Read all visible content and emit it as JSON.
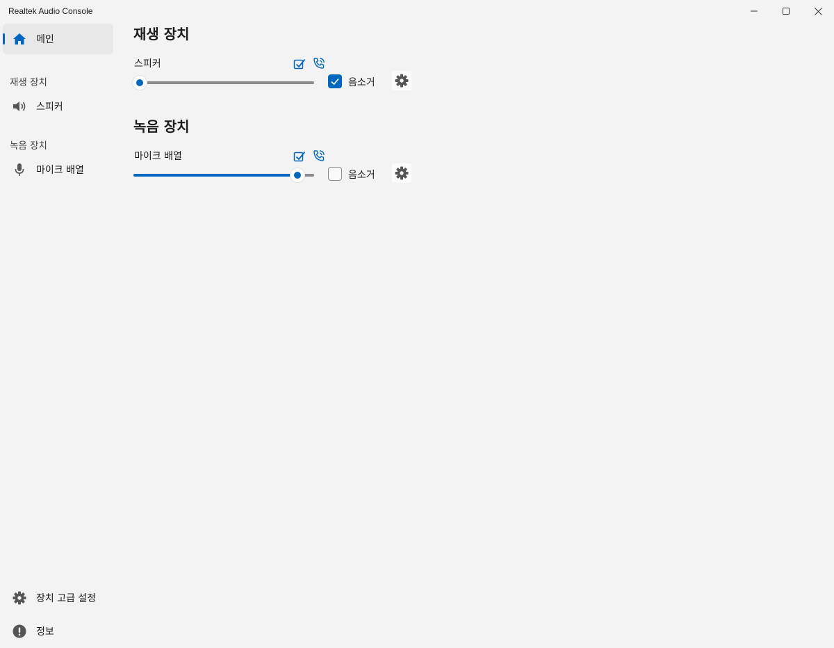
{
  "window": {
    "title": "Realtek Audio Console"
  },
  "sidebar": {
    "home_label": "메인",
    "playback_header": "재생 장치",
    "playback_item": "스피커",
    "recording_header": "녹음 장치",
    "recording_item": "마이크 배열",
    "advanced_label": "장치 고급 설정",
    "info_label": "정보"
  },
  "main": {
    "playback": {
      "title": "재생 장치",
      "device": "스피커",
      "volume": 0,
      "muted": true,
      "mute_label": "음소거"
    },
    "recording": {
      "title": "녹음 장치",
      "device": "마이크 배열",
      "volume": 94,
      "muted": false,
      "mute_label": "음소거"
    }
  },
  "colors": {
    "accent": "#0067c0",
    "background": "#f3f3f3",
    "selected": "#e8e8e8"
  },
  "icons": [
    "home-icon",
    "speaker-icon",
    "microphone-icon",
    "gear-icon",
    "info-icon",
    "default-device-check-icon",
    "communication-phone-icon",
    "minimize-icon",
    "maximize-icon",
    "close-icon"
  ]
}
